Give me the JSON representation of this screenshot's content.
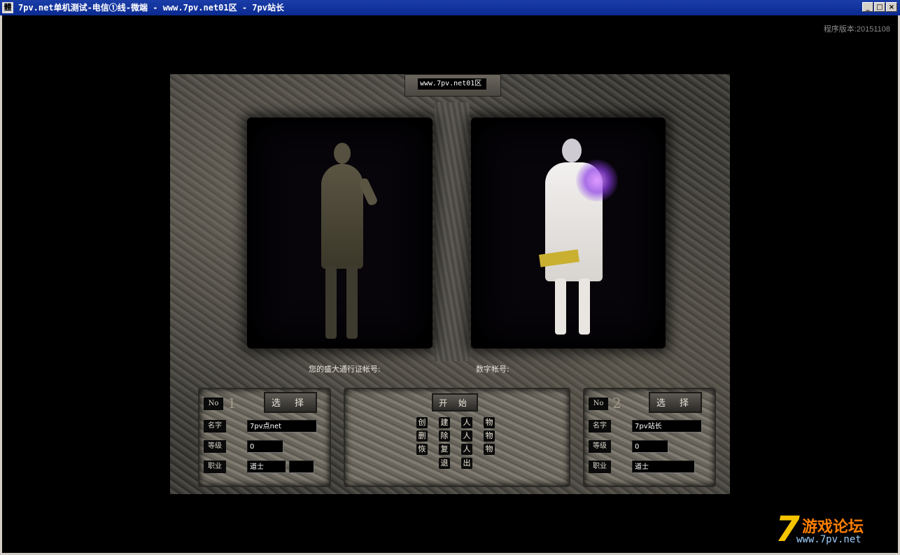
{
  "window": {
    "title": "7pv.net单机测试-电信①线-微端 - www.7pv.net01区 - 7pv站长",
    "icon": "app-icon",
    "icon_glyph": "體",
    "min_glyph": "_",
    "max_glyph": "□",
    "close_glyph": "×"
  },
  "version_text": "程序版本:20151108",
  "server_name": "www.7pv.net01区",
  "account": {
    "shanda_label": "您的盛大通行证帐号:",
    "digital_label": "数字帐号:"
  },
  "labels": {
    "no": "No",
    "select": "选 择",
    "name": "名字",
    "level": "等级",
    "job": "职业"
  },
  "slot1": {
    "number": "1",
    "name": "7pv点net",
    "level": "0",
    "job": "道士"
  },
  "slot2": {
    "number": "2",
    "name": "7pv站长",
    "level": "0",
    "job": "道士"
  },
  "menu": {
    "start": "开 始",
    "create": [
      "创",
      "建",
      "人",
      "物"
    ],
    "delete": [
      "删",
      "除",
      "人",
      "物"
    ],
    "restore": [
      "恢",
      "复",
      "人",
      "物"
    ],
    "exit": [
      "退",
      "出"
    ]
  },
  "watermark": {
    "seven": "7",
    "text": "游戏论坛",
    "url": "www.7pv.net"
  },
  "colors": {
    "titlebar": "#0a2a90",
    "glow": "#b070ff"
  }
}
